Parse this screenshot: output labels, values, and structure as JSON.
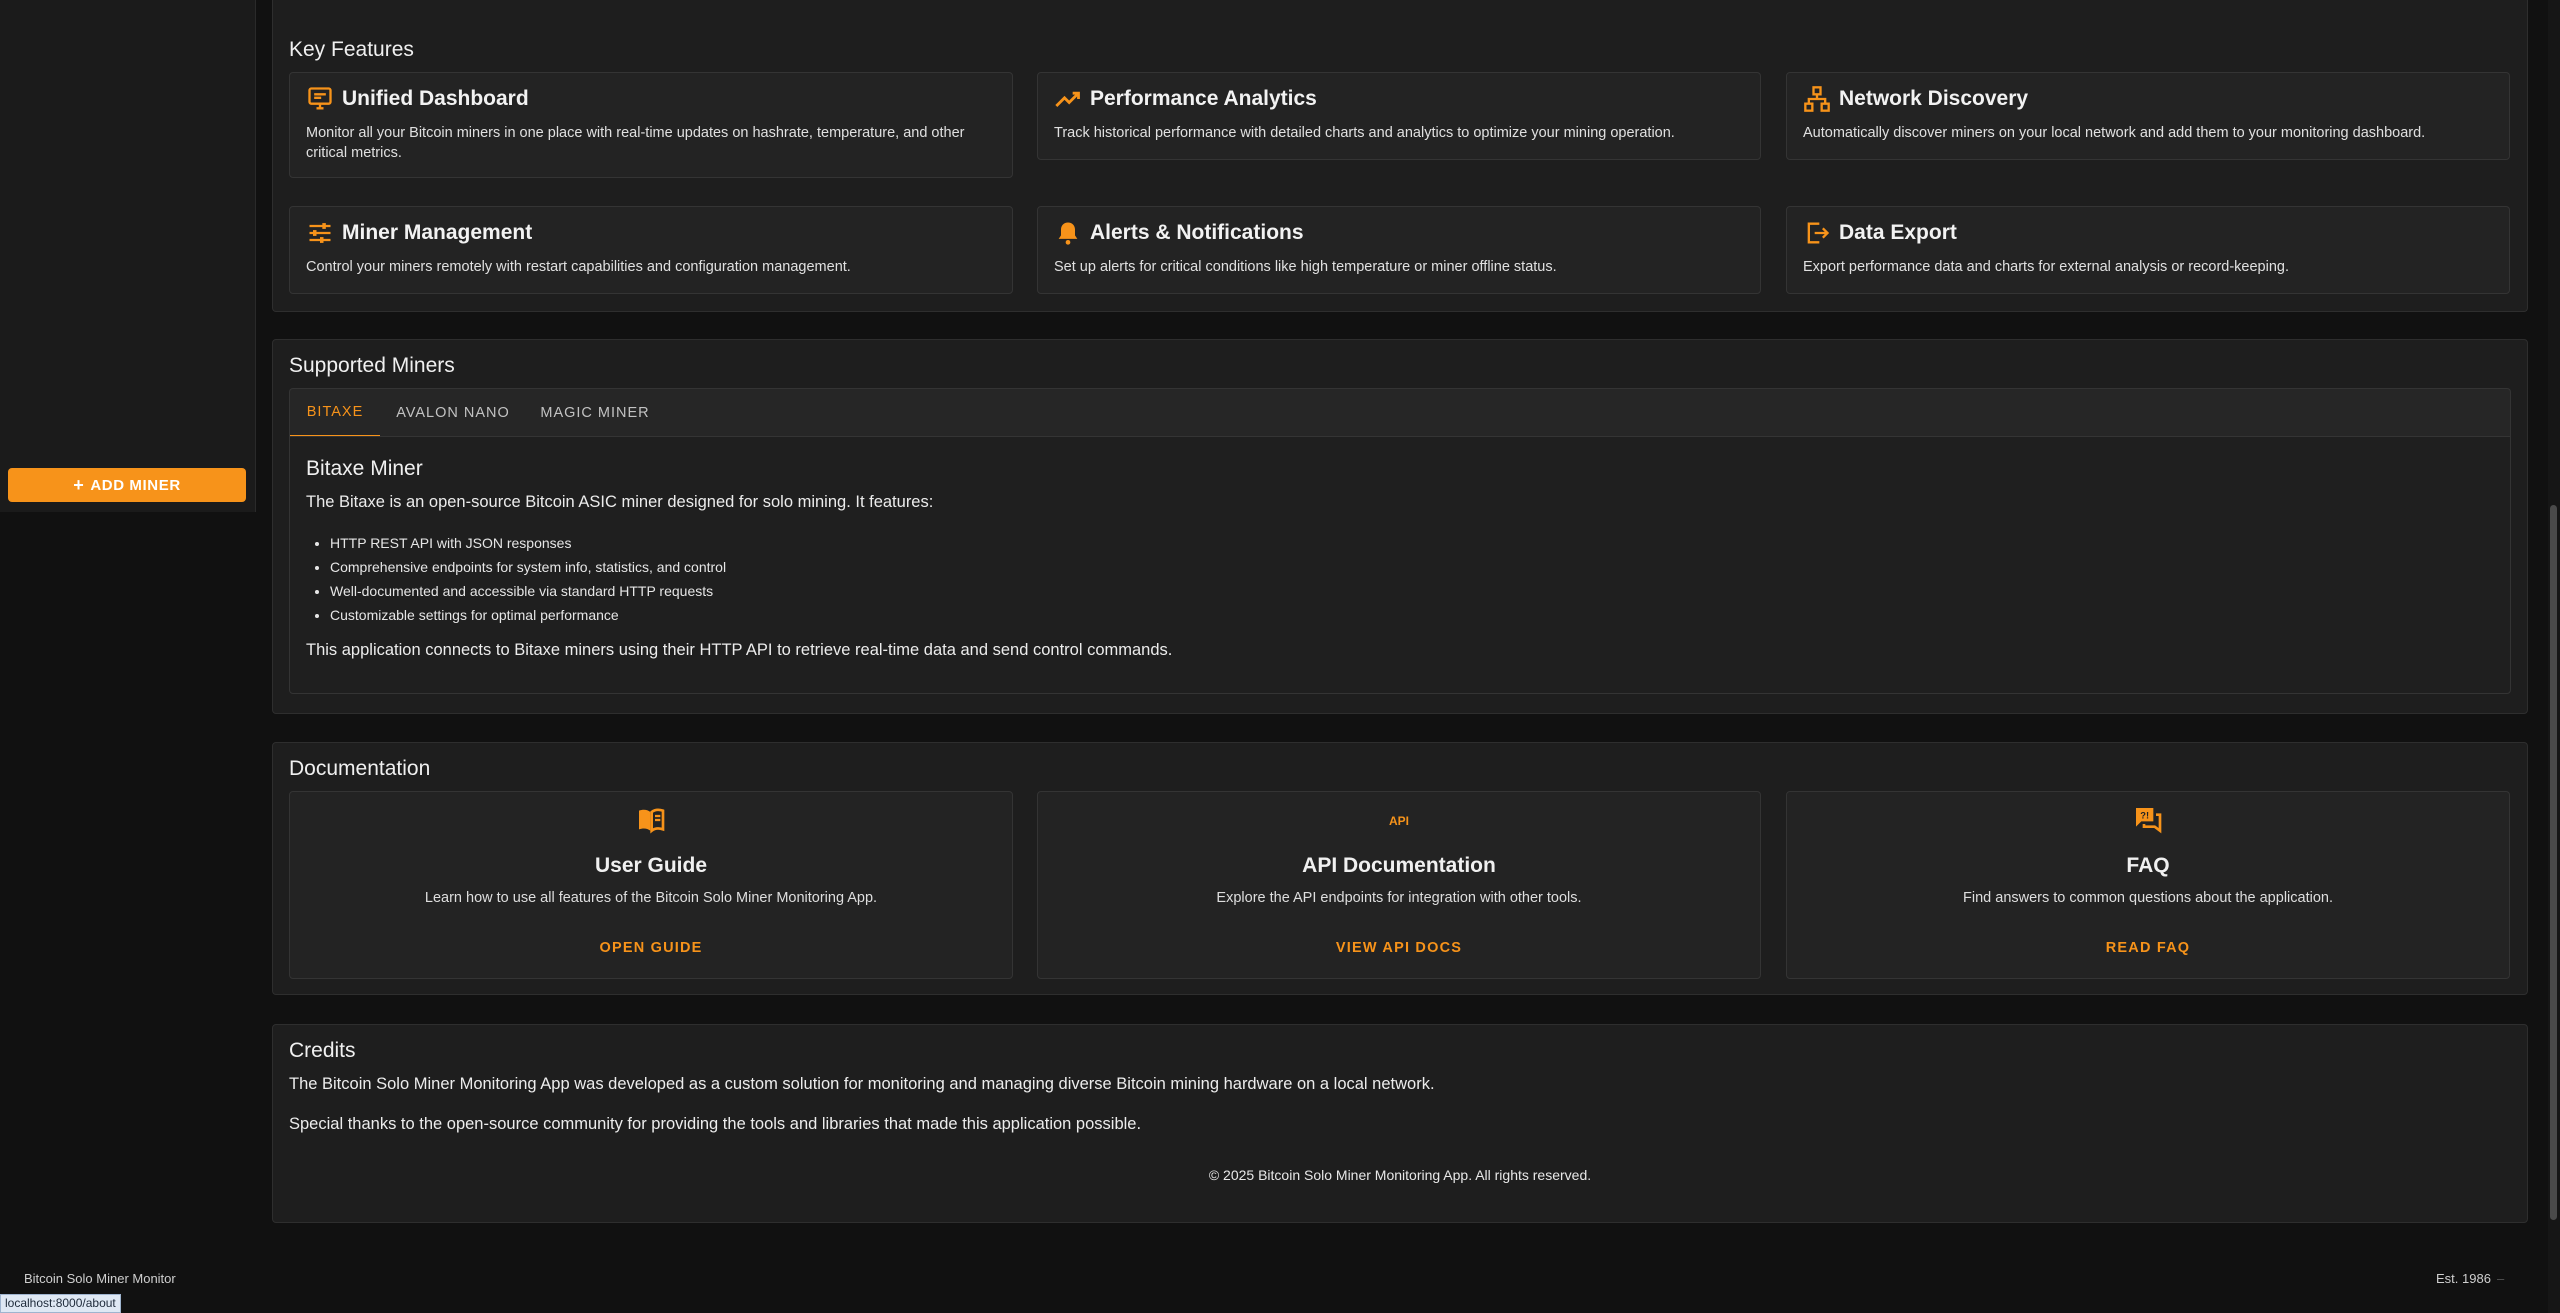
{
  "sidebar": {
    "add_miner_label": "ADD MINER"
  },
  "features": {
    "title": "Key Features",
    "items": [
      {
        "title": "Unified Dashboard",
        "icon": "dashboard-icon",
        "desc": "Monitor all your Bitcoin miners in one place with real-time updates on hashrate, temperature, and other critical metrics."
      },
      {
        "title": "Performance Analytics",
        "icon": "trending-up-icon",
        "desc": "Track historical performance with detailed charts and analytics to optimize your mining operation."
      },
      {
        "title": "Network Discovery",
        "icon": "network-icon",
        "desc": "Automatically discover miners on your local network and add them to your monitoring dashboard."
      },
      {
        "title": "Miner Management",
        "icon": "sliders-icon",
        "desc": "Control your miners remotely with restart capabilities and configuration management."
      },
      {
        "title": "Alerts & Notifications",
        "icon": "bell-icon",
        "desc": "Set up alerts for critical conditions like high temperature or miner offline status."
      },
      {
        "title": "Data Export",
        "icon": "export-icon",
        "desc": "Export performance data and charts for external analysis or record-keeping."
      }
    ]
  },
  "supported": {
    "title": "Supported Miners",
    "tabs": [
      "BITAXE",
      "AVALON NANO",
      "MAGIC MINER"
    ],
    "active_tab": "BITAXE",
    "panel": {
      "heading": "Bitaxe Miner",
      "intro": "The Bitaxe is an open-source Bitcoin ASIC miner designed for solo mining. It features:",
      "list": [
        "HTTP REST API with JSON responses",
        "Comprehensive endpoints for system info, statistics, and control",
        "Well-documented and accessible via standard HTTP requests",
        "Customizable settings for optimal performance"
      ],
      "outro": "This application connects to Bitaxe miners using their HTTP API to retrieve real-time data and send control commands."
    }
  },
  "documentation": {
    "title": "Documentation",
    "cards": [
      {
        "icon": "book-icon",
        "title": "User Guide",
        "desc": "Learn how to use all features of the Bitcoin Solo Miner Monitoring App.",
        "link": "OPEN GUIDE"
      },
      {
        "icon": "api-icon",
        "icon_text": "API",
        "title": "API Documentation",
        "desc": "Explore the API endpoints for integration with other tools.",
        "link": "VIEW API DOCS"
      },
      {
        "icon": "faq-icon",
        "title": "FAQ",
        "desc": "Find answers to common questions about the application.",
        "link": "READ FAQ"
      }
    ]
  },
  "credits": {
    "title": "Credits",
    "p1": "The Bitcoin Solo Miner Monitoring App was developed as a custom solution for monitoring and managing diverse Bitcoin mining hardware on a local network.",
    "p2": "Special thanks to the open-source community for providing the tools and libraries that made this application possible.",
    "copyright": "© 2025 Bitcoin Solo Miner Monitoring App. All rights reserved."
  },
  "footer": {
    "left": "Bitcoin Solo Miner Monitor",
    "right": "Est. 1986"
  },
  "status_bar": {
    "url": "localhost:8000/about"
  },
  "colors": {
    "accent": "#f7931a",
    "background": "#111111",
    "card": "#232323"
  }
}
